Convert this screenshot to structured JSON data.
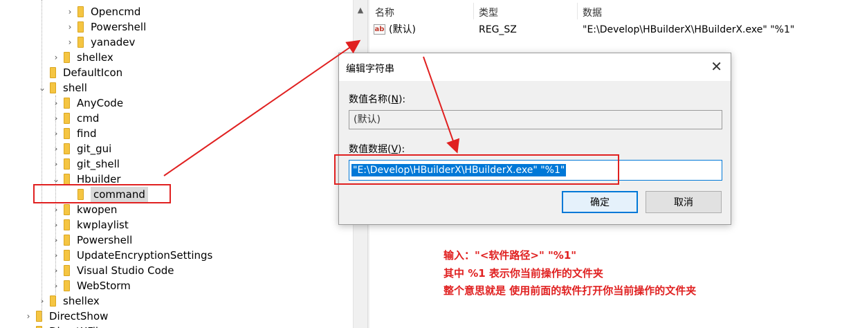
{
  "tree": [
    {
      "label": "Opencmd",
      "level": 3,
      "chevron": "right"
    },
    {
      "label": "Powershell",
      "level": 3,
      "chevron": "right"
    },
    {
      "label": "yanadev",
      "level": 3,
      "chevron": "right"
    },
    {
      "label": "shellex",
      "level": 2,
      "chevron": "right"
    },
    {
      "label": "DefaultIcon",
      "level": 1,
      "chevron": ""
    },
    {
      "label": "shell",
      "level": 1,
      "chevron": "down"
    },
    {
      "label": "AnyCode",
      "level": 2,
      "chevron": "right"
    },
    {
      "label": "cmd",
      "level": 2,
      "chevron": "right"
    },
    {
      "label": "find",
      "level": 2,
      "chevron": "right"
    },
    {
      "label": "git_gui",
      "level": 2,
      "chevron": "right"
    },
    {
      "label": "git_shell",
      "level": 2,
      "chevron": "right"
    },
    {
      "label": "Hbuilder",
      "level": 2,
      "chevron": "down"
    },
    {
      "label": "command",
      "level": 3,
      "chevron": "",
      "selected": true
    },
    {
      "label": "kwopen",
      "level": 2,
      "chevron": "right"
    },
    {
      "label": "kwplaylist",
      "level": 2,
      "chevron": "right"
    },
    {
      "label": "Powershell",
      "level": 2,
      "chevron": "right"
    },
    {
      "label": "UpdateEncryptionSettings",
      "level": 2,
      "chevron": "right"
    },
    {
      "label": "Visual Studio Code",
      "level": 2,
      "chevron": "right"
    },
    {
      "label": "WebStorm",
      "level": 2,
      "chevron": "right"
    },
    {
      "label": "shellex",
      "level": 1,
      "chevron": "right"
    },
    {
      "label": "DirectShow",
      "level": 0,
      "chevron": "right"
    },
    {
      "label": "DirectXFile",
      "level": 0,
      "chevron": "right"
    }
  ],
  "columns": {
    "name": "名称",
    "type": "类型",
    "data": "数据"
  },
  "values_row": {
    "name": "(默认)",
    "type": "REG_SZ",
    "data": "\"E:\\Develop\\HBuilderX\\HBuilderX.exe\" \"%1\"",
    "icon": "ab-string-icon"
  },
  "dialog": {
    "title": "编辑字符串",
    "name_label_prefix": "数值名称(",
    "name_label_key": "N",
    "name_label_suffix": "):",
    "name_value": "(默认)",
    "data_label_prefix": "数值数据(",
    "data_label_key": "V",
    "data_label_suffix": "):",
    "data_value": "\"E:\\Develop\\HBuilderX\\HBuilderX.exe\" \"%1\"",
    "ok": "确定",
    "cancel": "取消",
    "close": "✕"
  },
  "annotations": [
    "输入：\"<软件路径>\" \"%1\"",
    "其中 %1 表示你当前操作的文件夹",
    "整个意思就是 使用前面的软件打开你当前操作的文件夹"
  ],
  "colors": {
    "annotation": "#e02020",
    "highlight_box": "#e02020",
    "selection": "#0078d7"
  }
}
